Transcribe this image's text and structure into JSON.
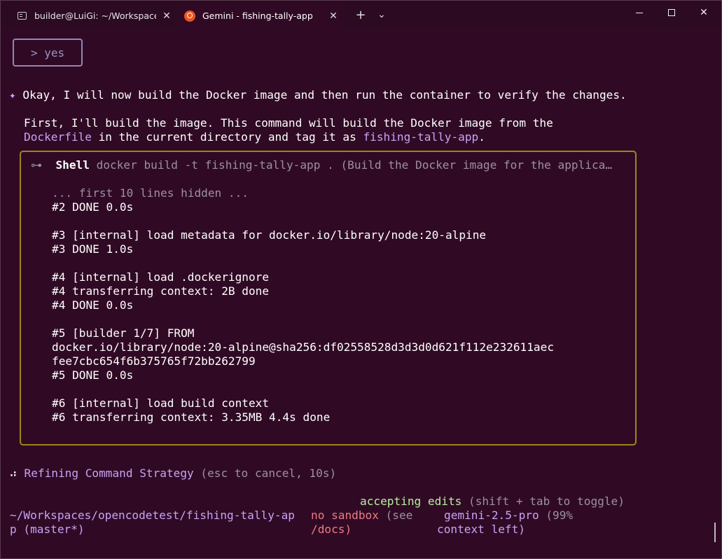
{
  "tabs": [
    {
      "label": "builder@LuiGi: ~/Workspaces/",
      "icon": "terminal-icon"
    },
    {
      "label": "Gemini - fishing-tally-app",
      "icon": "ubuntu-icon"
    }
  ],
  "tab_controls": {
    "new_tab": "+",
    "dropdown": "⌄",
    "close": "✕"
  },
  "window_controls": {
    "minimize": "─",
    "maximize": "□",
    "close": "✕"
  },
  "user_reply": "> yes",
  "gemini_star": "✦",
  "assistant_message": "Okay, I will now build the Docker image and then run the container to verify the changes.",
  "explain": {
    "line1": "First, I'll build the image. This command will build the Docker image from the",
    "line2_a": "Dockerfile",
    "line2_b": " in the current directory and tag it as ",
    "line2_c": "fishing-tally-app",
    "line2_d": "."
  },
  "shell": {
    "icon_glyph": "⊶",
    "label": "Shell",
    "command": "docker build -t fishing-tally-app . (Build the Docker image for the applica…",
    "hidden_note": "... first 10 lines hidden ...",
    "output": [
      "#2 DONE 0.0s",
      "",
      "#3 [internal] load metadata for docker.io/library/node:20-alpine",
      "#3 DONE 1.0s",
      "",
      "#4 [internal] load .dockerignore",
      "#4 transferring context: 2B done",
      "#4 DONE 0.0s",
      "",
      "#5 [builder 1/7] FROM",
      "docker.io/library/node:20-alpine@sha256:df02558528d3d3d0d621f112e232611aec",
      "fee7cbc654f6b375765f72bb262799",
      "#5 DONE 0.0s",
      "",
      "#6 [internal] load build context",
      "#6 transferring context: 3.35MB 4.4s done"
    ]
  },
  "status": {
    "spinner": "⠴",
    "thought": "Refining Command Strategy",
    "hint": " (esc to cancel, 10s)"
  },
  "footer": {
    "accepting_label": "accepting edits",
    "accepting_hint": " (shift + tab to toggle)",
    "path_line1": "~/Workspaces/opencodetest/fishing-tally-ap",
    "path_line2": "p (master*)",
    "sandbox_label": "no sandbox",
    "sandbox_hint_1": " (see",
    "sandbox_hint_2": "/docs)",
    "model": "gemini-2.5-pro",
    "context_1": " (99%",
    "context_2": "context left)"
  },
  "colors": {
    "background": "#300a24",
    "accent_purple": "#c7a3f5",
    "box_border_yellow": "#a08418",
    "green": "#b6f0a0",
    "red": "#f07a86"
  }
}
